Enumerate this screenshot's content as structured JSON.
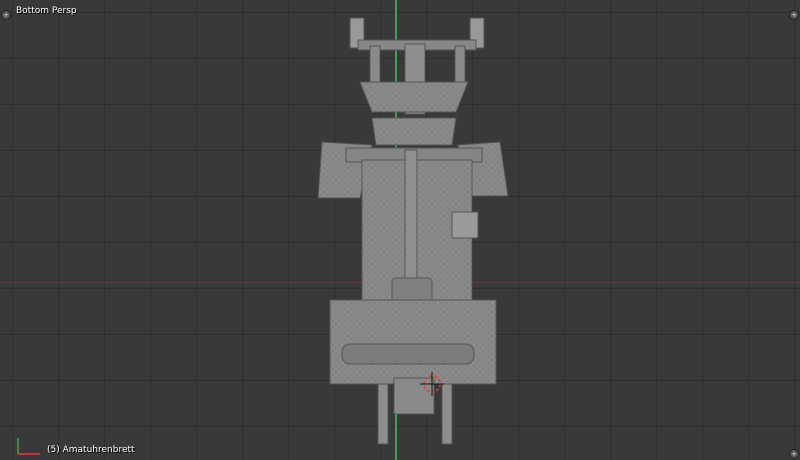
{
  "viewport": {
    "view_label": "Bottom Persp",
    "object_label": "(5) Amatuhrenbrett"
  },
  "corner_widgets": {
    "top_left": "+",
    "top_right": "+",
    "bottom_right": "+"
  },
  "colors": {
    "background": "#393939",
    "grid": "#2e2e2e",
    "x_axis": "#7a3a3a",
    "y_axis": "#3aa646",
    "mesh": "#8a8a8a",
    "cursor_red": "#e23a3a"
  },
  "icons": [
    "plus-icon",
    "3d-cursor-icon",
    "axis-gizmo-icon"
  ]
}
